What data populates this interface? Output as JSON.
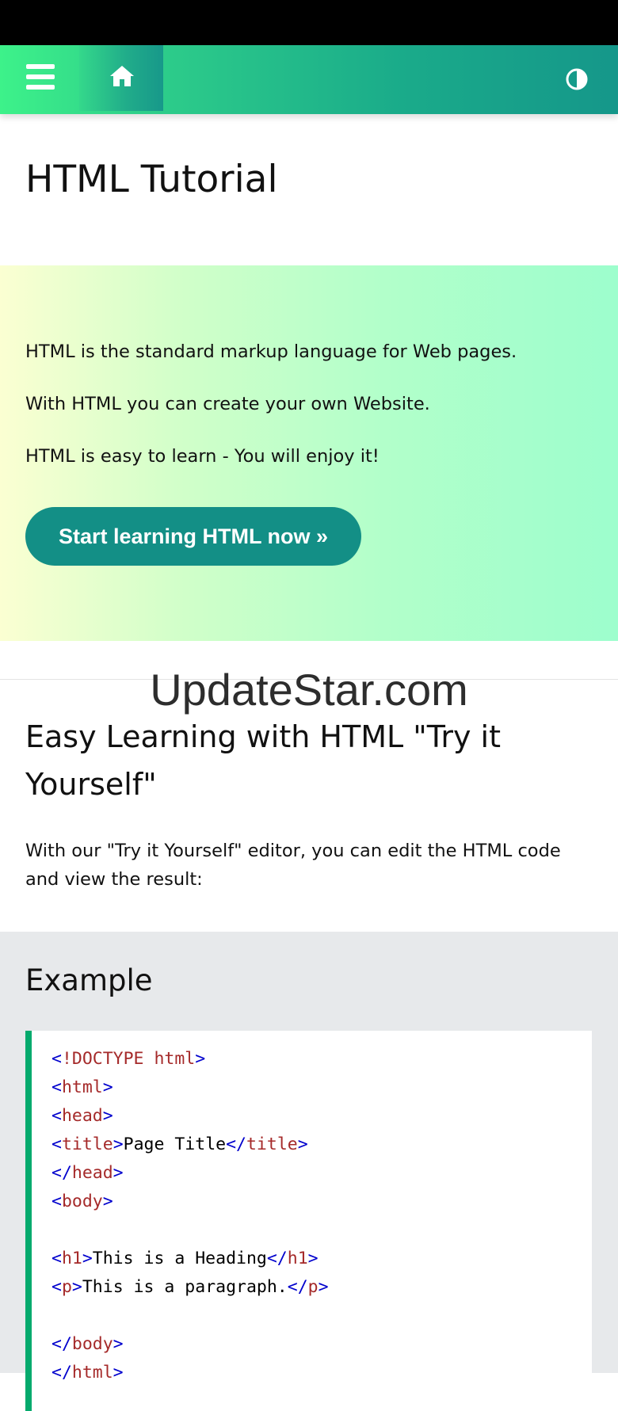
{
  "nav": {
    "menu_icon": "hamburger-menu-icon",
    "home_icon": "home-icon",
    "theme_icon": "half-circle-contrast-icon",
    "colors": {
      "gradient_start": "#3df28a",
      "gradient_end": "#15978a"
    }
  },
  "page_title": "HTML Tutorial",
  "hero": {
    "lines": [
      "HTML is the standard markup language for Web pages.",
      "With HTML you can create your own Website.",
      "HTML is easy to learn - You will enjoy it!"
    ],
    "cta_label": "Start learning HTML now »",
    "cta_color": "#138f86"
  },
  "watermark": "UpdateStar.com",
  "section": {
    "heading": "Easy Learning with HTML \"Try it Yourself\"",
    "text": "With our \"Try it Yourself\" editor, you can edit the HTML code and view the result:"
  },
  "example": {
    "title": "Example",
    "code_lines": [
      {
        "parts": [
          [
            "br",
            "<"
          ],
          [
            "tg",
            "!DOCTYPE html"
          ],
          [
            "br",
            ">"
          ]
        ]
      },
      {
        "parts": [
          [
            "br",
            "<"
          ],
          [
            "tg",
            "html"
          ],
          [
            "br",
            ">"
          ]
        ]
      },
      {
        "parts": [
          [
            "br",
            "<"
          ],
          [
            "tg",
            "head"
          ],
          [
            "br",
            ">"
          ]
        ]
      },
      {
        "parts": [
          [
            "br",
            "<"
          ],
          [
            "tg",
            "title"
          ],
          [
            "br",
            ">"
          ],
          [
            "tx",
            "Page Title"
          ],
          [
            "br",
            "</"
          ],
          [
            "tg",
            "title"
          ],
          [
            "br",
            ">"
          ]
        ]
      },
      {
        "parts": [
          [
            "br",
            "</"
          ],
          [
            "tg",
            "head"
          ],
          [
            "br",
            ">"
          ]
        ]
      },
      {
        "parts": [
          [
            "br",
            "<"
          ],
          [
            "tg",
            "body"
          ],
          [
            "br",
            ">"
          ]
        ]
      },
      {
        "parts": []
      },
      {
        "parts": [
          [
            "br",
            "<"
          ],
          [
            "tg",
            "h1"
          ],
          [
            "br",
            ">"
          ],
          [
            "tx",
            "This is a Heading"
          ],
          [
            "br",
            "</"
          ],
          [
            "tg",
            "h1"
          ],
          [
            "br",
            ">"
          ]
        ]
      },
      {
        "parts": [
          [
            "br",
            "<"
          ],
          [
            "tg",
            "p"
          ],
          [
            "br",
            ">"
          ],
          [
            "tx",
            "This is a paragraph."
          ],
          [
            "br",
            "</"
          ],
          [
            "tg",
            "p"
          ],
          [
            "br",
            ">"
          ]
        ]
      },
      {
        "parts": []
      },
      {
        "parts": [
          [
            "br",
            "</"
          ],
          [
            "tg",
            "body"
          ],
          [
            "br",
            ">"
          ]
        ]
      },
      {
        "parts": [
          [
            "br",
            "</"
          ],
          [
            "tg",
            "html"
          ],
          [
            "br",
            ">"
          ]
        ]
      }
    ]
  }
}
